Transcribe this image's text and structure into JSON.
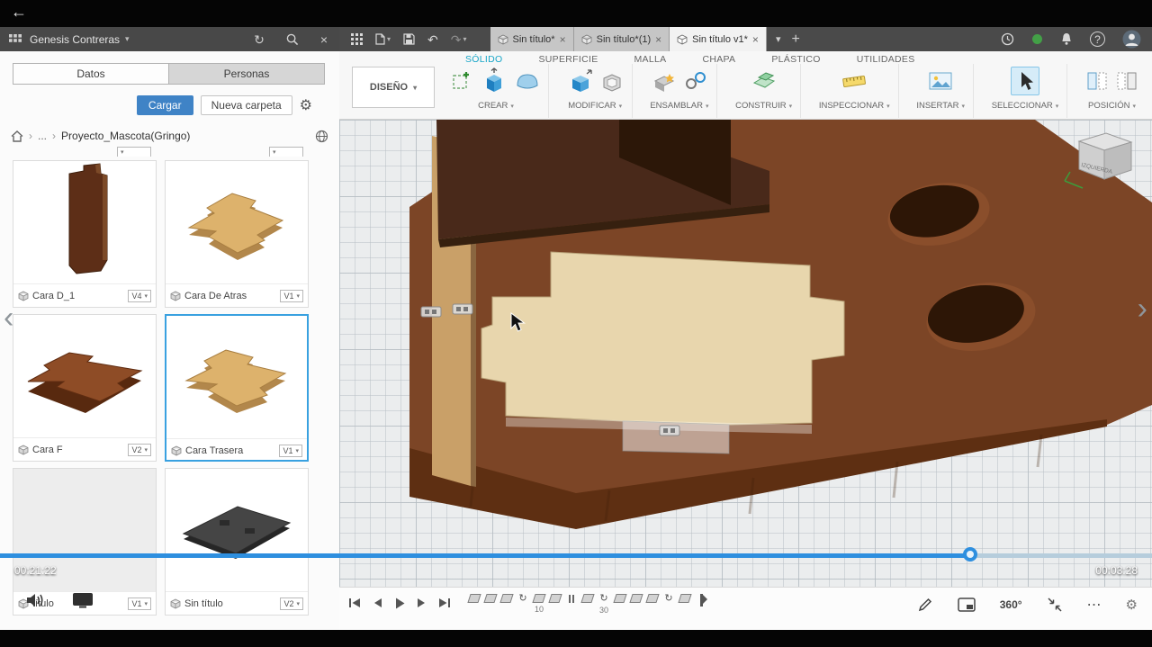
{
  "icons": {
    "back": "←",
    "chevron_down": "▾",
    "close": "×",
    "crumb_sep": "›",
    "more_dots": "⋯",
    "undo": "↶",
    "redo": "↷",
    "refresh": "↻",
    "gear": "⚙",
    "plus": "+",
    "help": "?",
    "rotate_marker": "↻",
    "nav_left": "‹",
    "nav_right": "›",
    "three_sixty": "360°"
  },
  "player": {
    "current_time": "00:21:22",
    "total_time": "00:03:28",
    "progress_percent": 84.2
  },
  "panel": {
    "user_name": "Genesis Contreras",
    "tabs": {
      "datos": "Datos",
      "personas": "Personas"
    },
    "upload_button": "Cargar",
    "new_folder_button": "Nueva carpeta",
    "breadcrumb": {
      "ellipsis": "...",
      "project": "Proyecto_Mascota(Gringo)"
    },
    "cards": [
      {
        "name": "Cara D_1",
        "version": "V4"
      },
      {
        "name": "Cara De Atras",
        "version": "V1"
      },
      {
        "name": "Cara F",
        "version": "V2"
      },
      {
        "name": "Cara Trasera",
        "version": "V1"
      },
      {
        "name": "título",
        "version": "V1"
      },
      {
        "name": "Sin título",
        "version": "V2"
      }
    ]
  },
  "qat": {
    "tabs": [
      {
        "label": "Sin título*"
      },
      {
        "label": "Sin título*(1)"
      },
      {
        "label": "Sin título v1*"
      }
    ]
  },
  "ribbon": {
    "context_menu": "DISEÑO",
    "tabs": [
      {
        "label": "SÓLIDO"
      },
      {
        "label": "SUPERFICIE"
      },
      {
        "label": "MALLA"
      },
      {
        "label": "CHAPA"
      },
      {
        "label": "PLÁSTICO"
      },
      {
        "label": "UTILIDADES"
      }
    ],
    "groups": [
      {
        "label": "CREAR"
      },
      {
        "label": "MODIFICAR"
      },
      {
        "label": "ENSAMBLAR"
      },
      {
        "label": "CONSTRUIR"
      },
      {
        "label": "INSPECCIONAR"
      },
      {
        "label": "INSERTAR"
      },
      {
        "label": "SELECCIONAR"
      },
      {
        "label": "POSICIÓN"
      }
    ]
  },
  "viewport": {
    "viewcube_label": "IZQUIERDA"
  },
  "fusion_timeline": {
    "markers": [
      {
        "type": "sketch"
      },
      {
        "type": "sketch"
      },
      {
        "type": "sketch"
      },
      {
        "type": "revolve"
      },
      {
        "type": "sketch",
        "num": "10"
      },
      {
        "type": "sketch"
      },
      {
        "type": "pause"
      },
      {
        "type": "sketch"
      },
      {
        "type": "revolve",
        "num": "30"
      },
      {
        "type": "sketch"
      },
      {
        "type": "sketch"
      },
      {
        "type": "sketch"
      },
      {
        "type": "revolve"
      },
      {
        "type": "sketch"
      },
      {
        "type": "end"
      }
    ]
  }
}
